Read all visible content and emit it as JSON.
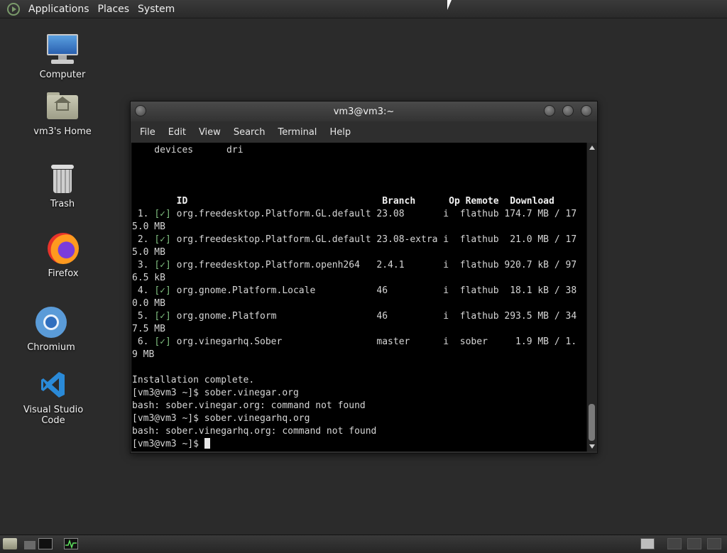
{
  "top_panel": {
    "menus": [
      "Applications",
      "Places",
      "System"
    ]
  },
  "desktop_icons": [
    {
      "label": "Computer",
      "icon": "computer-icon"
    },
    {
      "label": "vm3's Home",
      "icon": "home-folder-icon"
    },
    {
      "label": "Trash",
      "icon": "trash-icon"
    },
    {
      "label": "Firefox",
      "icon": "firefox-icon"
    },
    {
      "label": "Chromium",
      "icon": "chromium-icon"
    },
    {
      "label": "Visual Studio Code",
      "icon": "vscode-icon"
    }
  ],
  "terminal": {
    "title": "vm3@vm3:~",
    "menus": [
      "File",
      "Edit",
      "View",
      "Search",
      "Terminal",
      "Help"
    ],
    "pre_lines": [
      "    devices      dri",
      "",
      "",
      ""
    ],
    "table_header": "        ID                                   Branch      Op Remote  Download",
    "rows": [
      {
        "num": " 1.",
        "check": "[✓]",
        "rest": " org.freedesktop.Platform.GL.default 23.08       i  flathub 174.7 MB / 17",
        "wrap": "5.0 MB"
      },
      {
        "num": " 2.",
        "check": "[✓]",
        "rest": " org.freedesktop.Platform.GL.default 23.08-extra i  flathub  21.0 MB / 17",
        "wrap": "5.0 MB"
      },
      {
        "num": " 3.",
        "check": "[✓]",
        "rest": " org.freedesktop.Platform.openh264   2.4.1       i  flathub 920.7 kB / 97",
        "wrap": "6.5 kB"
      },
      {
        "num": " 4.",
        "check": "[✓]",
        "rest": " org.gnome.Platform.Locale           46          i  flathub  18.1 kB / 38",
        "wrap": "0.0 MB"
      },
      {
        "num": " 5.",
        "check": "[✓]",
        "rest": " org.gnome.Platform                  46          i  flathub 293.5 MB / 34",
        "wrap": "7.5 MB"
      },
      {
        "num": " 6.",
        "check": "[✓]",
        "rest": " org.vinegarhq.Sober                 master      i  sober     1.9 MB / 1.",
        "wrap": "9 MB"
      }
    ],
    "post_lines": [
      "",
      "Installation complete.",
      "[vm3@vm3 ~]$ sober.vinegar.org",
      "bash: sober.vinegar.org: command not found",
      "[vm3@vm3 ~]$ sober.vinegarhq.org",
      "bash: sober.vinegarhq.org: command not found"
    ],
    "prompt": "[vm3@vm3 ~]$ "
  },
  "colors": {
    "desktop_bg": "#2b2b2b",
    "terminal_bg": "#000000",
    "terminal_fg": "#d6d6d6",
    "check_green": "#7fbf7f"
  }
}
